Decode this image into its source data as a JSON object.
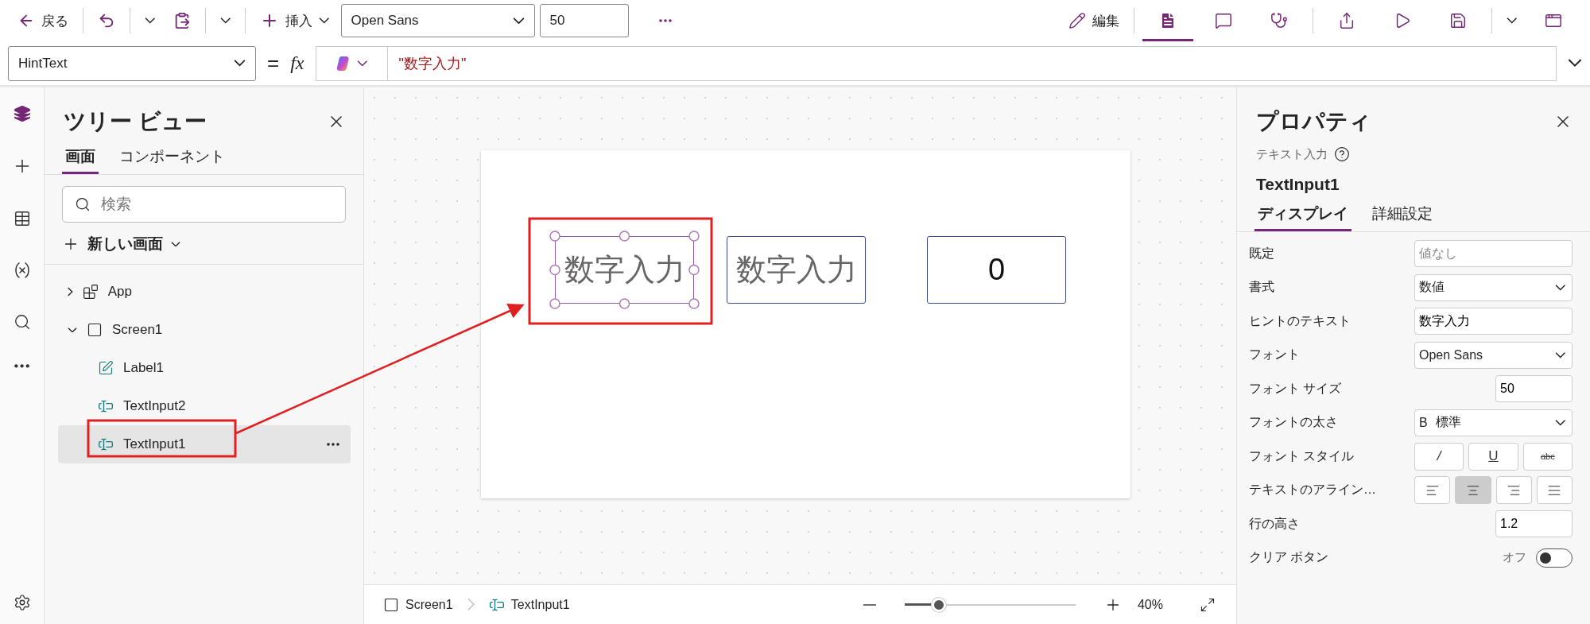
{
  "toolbar": {
    "back": "戻る",
    "insert": "挿入",
    "font": "Open Sans",
    "font_size": "50",
    "edit": "編集",
    "tools": [
      {
        "kind": "tree",
        "selected": true
      },
      {
        "kind": "comment",
        "selected": false
      },
      {
        "kind": "checker",
        "selected": false
      }
    ]
  },
  "formula_bar": {
    "property": "HintText",
    "equals": "=",
    "fx": "fx",
    "formula": "\"数字入力\""
  },
  "tree_view": {
    "title": "ツリー ビュー",
    "tabs": [
      {
        "label": "画面",
        "selected": true
      },
      {
        "label": "コンポーネント",
        "selected": false
      }
    ],
    "search_placeholder": "検索",
    "new_screen": "新しい画面",
    "items": [
      {
        "label": "App",
        "kind": "app",
        "expanded": false,
        "selected": false
      },
      {
        "label": "Screen1",
        "kind": "screen",
        "expanded": true,
        "selected": false,
        "children": [
          {
            "label": "Label1",
            "kind": "label",
            "selected": false
          },
          {
            "label": "TextInput2",
            "kind": "textinput",
            "selected": false
          },
          {
            "label": "TextInput1",
            "kind": "textinput",
            "selected": true
          }
        ]
      }
    ]
  },
  "canvas": {
    "controls": [
      {
        "kind": "textinput",
        "placeholder": "数字入力",
        "selected": true
      },
      {
        "kind": "textinput",
        "placeholder": "数字入力",
        "selected": false
      },
      {
        "kind": "textinput",
        "value": "0",
        "selected": false
      }
    ]
  },
  "status_bar": {
    "breadcrumb": [
      {
        "label": "Screen1",
        "kind": "screen"
      },
      {
        "label": "TextInput1",
        "kind": "textinput"
      }
    ],
    "zoom": {
      "level": 0.2,
      "reading": "40%"
    }
  },
  "properties": {
    "title": "プロパティ",
    "control_type": "テキスト入力",
    "control_name": "TextInput1",
    "tabs": [
      {
        "label": "ディスプレイ",
        "selected": true
      },
      {
        "label": "詳細設定",
        "selected": false
      }
    ],
    "rows": [
      {
        "label": "既定",
        "kind": "input",
        "placeholder": "値なし"
      },
      {
        "label": "書式",
        "kind": "select",
        "value": "数値"
      },
      {
        "label": "ヒントのテキスト",
        "kind": "input",
        "value": "数字入力"
      },
      {
        "label": "フォント",
        "kind": "select",
        "value": "Open Sans"
      },
      {
        "label": "フォント サイズ",
        "kind": "number",
        "value": "50"
      },
      {
        "label": "フォントの太さ",
        "kind": "select",
        "prefix": "B",
        "value": "標準"
      },
      {
        "label": "フォント スタイル",
        "kind": "toggles",
        "options": [
          {
            "kind": "italic",
            "label": "/",
            "selected": false
          },
          {
            "kind": "underline",
            "label": "U",
            "selected": false
          },
          {
            "kind": "strikethrough",
            "label": "abc",
            "selected": false
          }
        ]
      },
      {
        "label": "テキストのアライン…",
        "kind": "align",
        "options": [
          {
            "kind": "left",
            "selected": false
          },
          {
            "kind": "center",
            "selected": true
          },
          {
            "kind": "right",
            "selected": false
          },
          {
            "kind": "justify",
            "selected": false
          }
        ]
      },
      {
        "label": "行の高さ",
        "kind": "number",
        "value": "1.2"
      },
      {
        "label": "クリア ボタン",
        "kind": "toggle",
        "state_label": "オフ",
        "on": false
      }
    ]
  }
}
